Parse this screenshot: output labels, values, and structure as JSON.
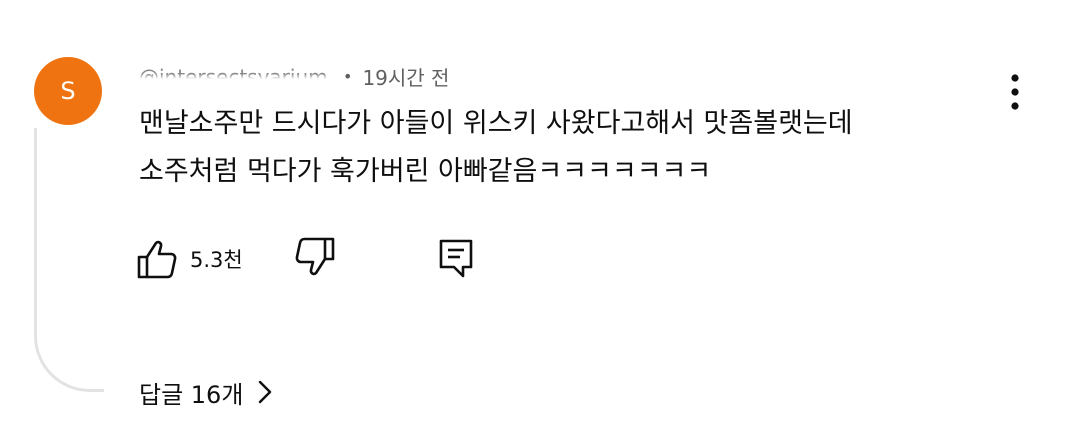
{
  "comment": {
    "avatar_letter": "S",
    "avatar_color": "#ef7411",
    "author_handle": "@intersectsvarium",
    "separator": "•",
    "timestamp": "19시간 전",
    "text_lines": [
      "맨날소주만 드시다가 아들이 위스키 사왔다고해서 맛좀볼랫는데",
      "소주처럼 먹다가 훅가버린 아빠같음ㅋㅋㅋㅋㅋㅋㅋ"
    ],
    "like_count": "5.3천",
    "replies_label": "답글 16개"
  },
  "icons": {
    "more": "more-vertical-icon",
    "like": "thumbs-up-icon",
    "dislike": "thumbs-down-icon",
    "reply": "comment-reply-icon",
    "chevron": "chevron-right-icon"
  }
}
